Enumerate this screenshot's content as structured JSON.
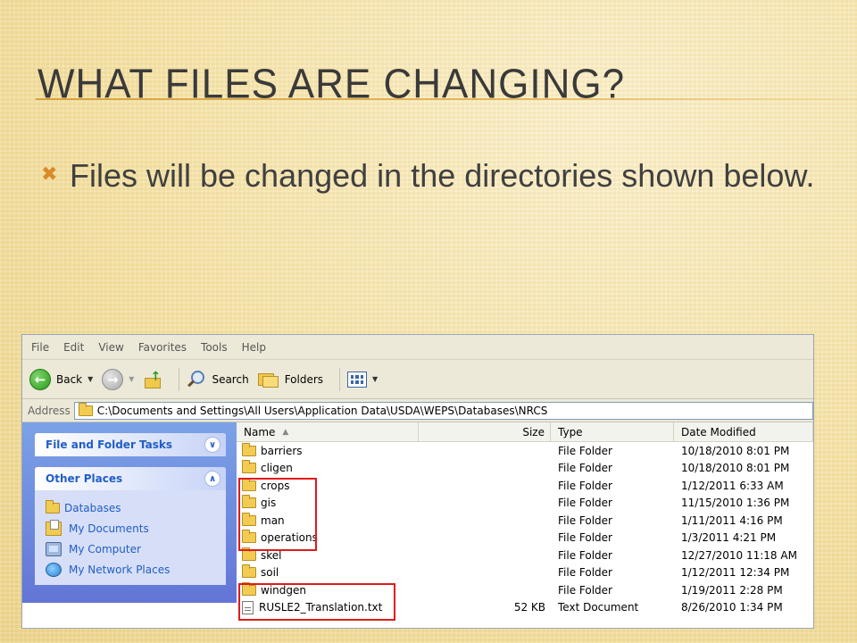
{
  "slide": {
    "title": "What files are changing?",
    "bullet_icon": "crossed-marker-icon",
    "bullet_text": "Files will be changed in the directories shown below."
  },
  "explorer": {
    "menu": [
      "File",
      "Edit",
      "View",
      "Favorites",
      "Tools",
      "Help"
    ],
    "toolbar": {
      "back_label": "Back",
      "search_label": "Search",
      "folders_label": "Folders"
    },
    "address": {
      "label": "Address",
      "path": "C:\\Documents and Settings\\All Users\\Application Data\\USDA\\WEPS\\Databases\\NRCS"
    },
    "taskpane": {
      "file_folder_tasks": "File and Folder Tasks",
      "other_places": "Other Places",
      "places": [
        {
          "label": "Databases",
          "icon": "folder-icon"
        },
        {
          "label": "My Documents",
          "icon": "my-documents-icon"
        },
        {
          "label": "My Computer",
          "icon": "my-computer-icon"
        },
        {
          "label": "My Network Places",
          "icon": "network-places-icon"
        }
      ]
    },
    "columns": {
      "name": "Name",
      "size": "Size",
      "type": "Type",
      "date": "Date Modified"
    },
    "files": [
      {
        "name": "barriers",
        "size": "",
        "type": "File Folder",
        "date": "10/18/2010 8:01 PM",
        "icon": "folder-icon"
      },
      {
        "name": "cligen",
        "size": "",
        "type": "File Folder",
        "date": "10/18/2010 8:01 PM",
        "icon": "folder-icon"
      },
      {
        "name": "crops",
        "size": "",
        "type": "File Folder",
        "date": "1/12/2011 6:33 AM",
        "icon": "folder-icon"
      },
      {
        "name": "gis",
        "size": "",
        "type": "File Folder",
        "date": "11/15/2010 1:36 PM",
        "icon": "folder-icon"
      },
      {
        "name": "man",
        "size": "",
        "type": "File Folder",
        "date": "1/11/2011 4:16 PM",
        "icon": "folder-icon"
      },
      {
        "name": "operations",
        "size": "",
        "type": "File Folder",
        "date": "1/3/2011 4:21 PM",
        "icon": "folder-icon"
      },
      {
        "name": "skel",
        "size": "",
        "type": "File Folder",
        "date": "12/27/2010 11:18 AM",
        "icon": "folder-icon"
      },
      {
        "name": "soil",
        "size": "",
        "type": "File Folder",
        "date": "1/12/2011 12:34 PM",
        "icon": "folder-icon"
      },
      {
        "name": "windgen",
        "size": "",
        "type": "File Folder",
        "date": "1/19/2011 2:28 PM",
        "icon": "folder-icon"
      },
      {
        "name": "RUSLE2_Translation.txt",
        "size": "52 KB",
        "type": "Text Document",
        "date": "8/26/2010 1:34 PM",
        "icon": "text-file-icon"
      }
    ],
    "highlight_color": "#e01a1a"
  }
}
